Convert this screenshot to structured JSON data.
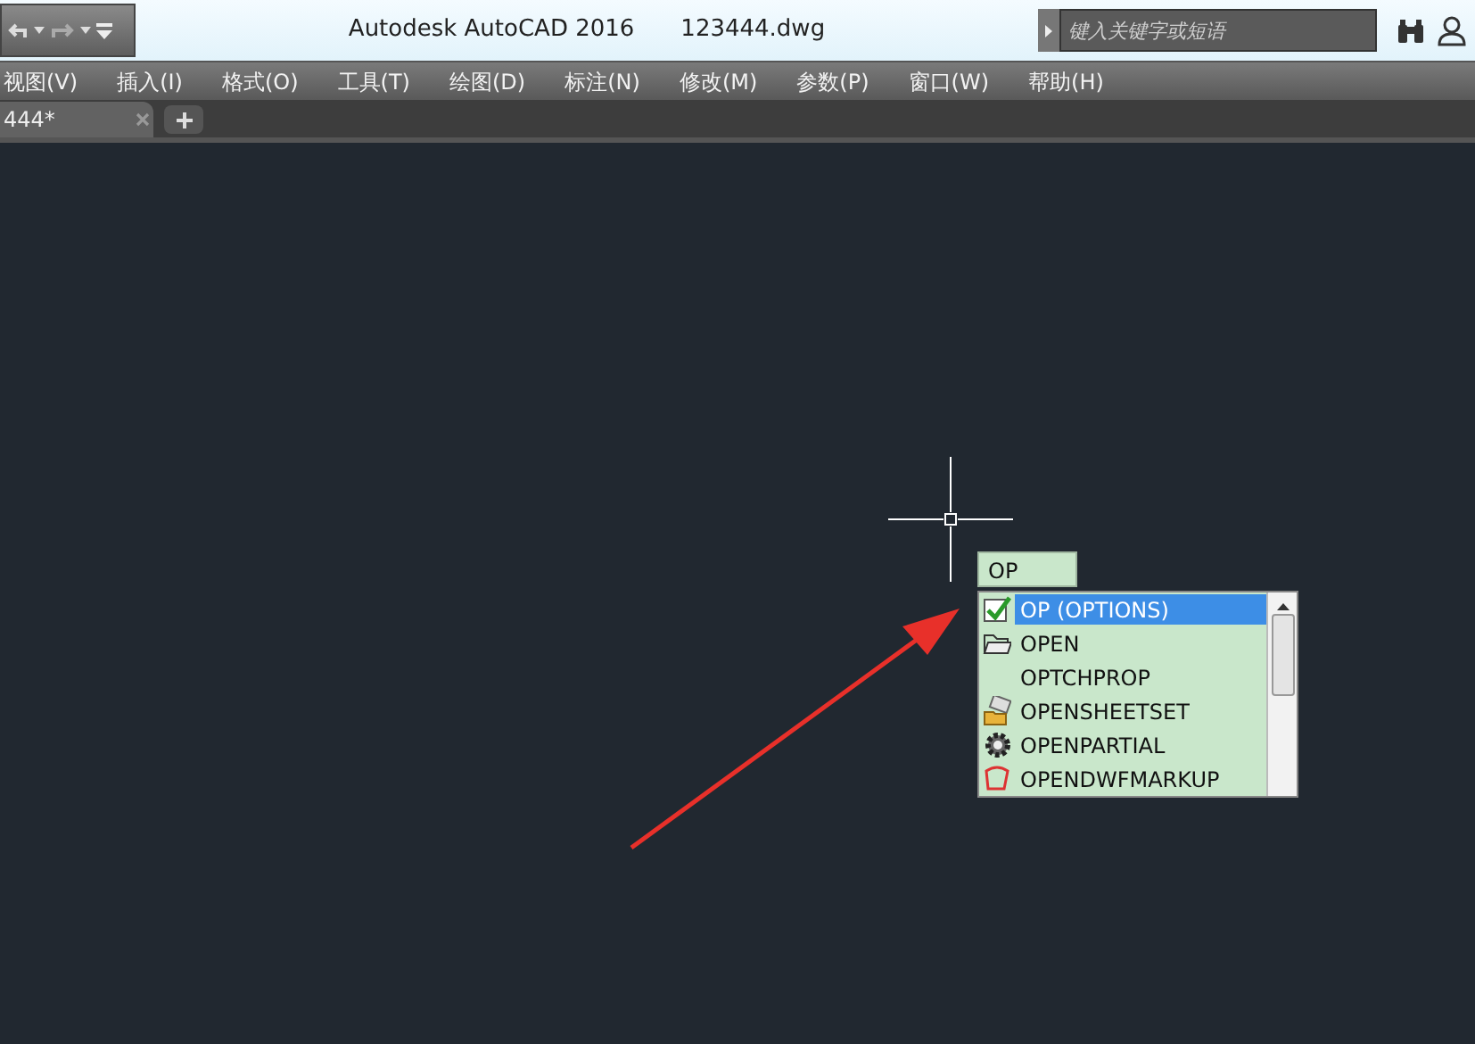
{
  "window": {
    "title": "Autodesk AutoCAD 2016",
    "file": "123444.dwg"
  },
  "search": {
    "placeholder": "键入关键字或短语"
  },
  "menu": [
    "视图(V)",
    "插入(I)",
    "格式(O)",
    "工具(T)",
    "绘图(D)",
    "标注(N)",
    "修改(M)",
    "参数(P)",
    "窗口(W)",
    "帮助(H)"
  ],
  "tabs": [
    {
      "label": "444*",
      "selected": true
    }
  ],
  "command": {
    "value": "OP"
  },
  "suggestions": [
    {
      "label": "OP (OPTIONS)",
      "kind": "check",
      "selected": true
    },
    {
      "label": "OPEN",
      "kind": "folder",
      "selected": false
    },
    {
      "label": "OPTCHPROP",
      "kind": "none",
      "selected": false
    },
    {
      "label": "OPENSHEETSET",
      "kind": "sheetset",
      "selected": false
    },
    {
      "label": "OPENPARTIAL",
      "kind": "gear",
      "selected": false
    },
    {
      "label": "OPENDWFMARKUP",
      "kind": "markup",
      "selected": false
    }
  ]
}
